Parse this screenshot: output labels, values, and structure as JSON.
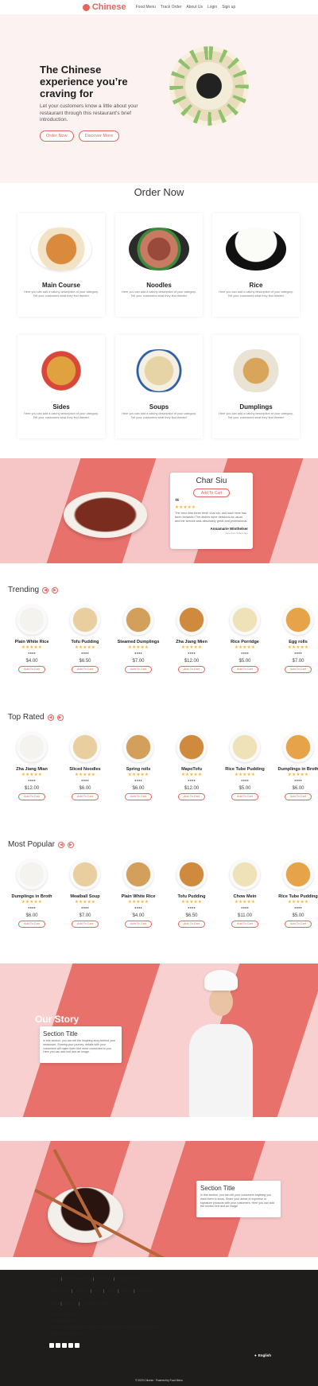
{
  "header": {
    "brand": "Chinese",
    "nav": [
      "Food Menu",
      "Track Order",
      "About Us",
      "Login",
      "Sign up"
    ]
  },
  "hero": {
    "title": "The Chinese experience you’re craving for",
    "subtitle": "Let your customers know a little about your restaurant through this restaurant's brief introduction.",
    "order_btn": "Order Now",
    "discover_btn": "Discover More"
  },
  "order": {
    "title": "Order Now",
    "desc": "Here you can add a catchy description of your category. Tell your customers what they find therein!",
    "categories": [
      "Main Course",
      "Noodles",
      "Rice",
      "Sides",
      "Soups",
      "Dumplings"
    ]
  },
  "charsiu": {
    "title": "Char Siu",
    "btn": "Add To Cart",
    "stars": "★★★★★",
    "review": "The best time-three fresh char siu, and each time has been fantastic! The dishes were delicious as usual, and the service was absolutely great and professional.",
    "author": "Annamarie Winthelser",
    "time": "more than 4 days ago"
  },
  "trending": {
    "title": "Trending",
    "items": [
      {
        "name": "Plain White Rice",
        "price": "$4.00"
      },
      {
        "name": "Tofu Pudding",
        "price": "$6.50"
      },
      {
        "name": "Steamed Dumplings",
        "price": "$7.00"
      },
      {
        "name": "Zha Jiang Mien",
        "price": "$12.00"
      },
      {
        "name": "Rice Porridge",
        "price": "$5.00"
      },
      {
        "name": "Egg rolls",
        "price": "$7.00"
      }
    ]
  },
  "toprated": {
    "title": "Top Rated",
    "items": [
      {
        "name": "Zha Jiang Mian",
        "price": "$12.00"
      },
      {
        "name": "Sliced Noodles",
        "price": "$6.00"
      },
      {
        "name": "Spring rolls",
        "price": "$6.00"
      },
      {
        "name": "MapoTofu",
        "price": "$12.00"
      },
      {
        "name": "Rice Tube Pudding",
        "price": "$5.00"
      },
      {
        "name": "Dumplings in Broth",
        "price": "$6.00"
      }
    ]
  },
  "popular": {
    "title": "Most Popular",
    "items": [
      {
        "name": "Dumplings in Broth",
        "price": "$6.00"
      },
      {
        "name": "Meatball Soup",
        "price": "$7.00"
      },
      {
        "name": "Plain White Rice",
        "price": "$4.00"
      },
      {
        "name": "Tofu Pudding",
        "price": "$6.50"
      },
      {
        "name": "Chow Mein",
        "price": "$11.00"
      },
      {
        "name": "Rice Tube Pudding",
        "price": "$5.00"
      }
    ]
  },
  "item_common": {
    "stars": "★★★★★",
    "add": "Add To Cart"
  },
  "story": {
    "heading": "Our Story",
    "card_title": "Section Title",
    "card_text": "In this section, you can tell the inspiring story behind your restaurant. Sharing your journey, details with your customers will make them feel more connected to you. Here you can add text and an image."
  },
  "section2": {
    "card_title": "Section Title",
    "card_text": "In this section, you can tell your customers anything you want them to know. Share your areas of expertise or signature products with your customers. Here you can add the section text and an image."
  },
  "footer": {
    "links1": [
      "Home",
      "All Our Products",
      "About Us",
      "Privacy Policy"
    ],
    "links2": [
      "Main Course",
      "Noodles",
      "Rice",
      "Sides",
      "Soups",
      "Dumplings"
    ],
    "links3": [
      "Login",
      "Sign up",
      "Track Your Order"
    ],
    "phone1": "+1-800-765-4321",
    "phone2": "+1-123-456-7890",
    "address": "10 San Pasquale Avenue NW, Albuquerque,nm, 87104 United States",
    "email": "chinese@example.com",
    "lang": "English",
    "copyright": "© 2023 Chinese · Powered by Food Menu"
  }
}
